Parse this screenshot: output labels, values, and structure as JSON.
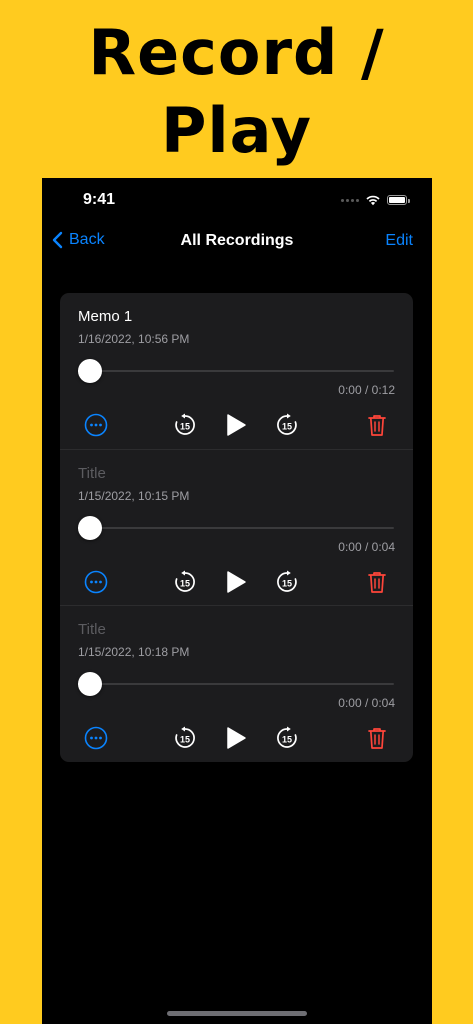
{
  "promo": {
    "line1": "Record /",
    "line2": "Play"
  },
  "status_bar": {
    "time": "9:41"
  },
  "nav": {
    "back_label": "Back",
    "title": "All Recordings",
    "edit_label": "Edit"
  },
  "recordings": [
    {
      "title": "Memo 1",
      "title_is_placeholder": false,
      "date": "1/16/2022, 10:56 PM",
      "time": "0:00 / 0:12",
      "progress": 0
    },
    {
      "title": "Title",
      "title_is_placeholder": true,
      "date": "1/15/2022, 10:15 PM",
      "time": "0:00 / 0:04",
      "progress": 0
    },
    {
      "title": "Title",
      "title_is_placeholder": true,
      "date": "1/15/2022, 10:18 PM",
      "time": "0:00 / 0:04",
      "progress": 0
    }
  ],
  "controls": {
    "more_icon": "ellipsis-circle-icon",
    "skip_back_icon": "gobackward-15-icon",
    "skip_back_seconds": "15",
    "play_icon": "play-icon",
    "skip_forward_icon": "goforward-15-icon",
    "skip_forward_seconds": "15",
    "delete_icon": "trash-icon"
  },
  "colors": {
    "background": "#FFCB1F",
    "accent": "#0A84FF",
    "destructive": "#FF453A",
    "card": "#1C1C1E"
  }
}
